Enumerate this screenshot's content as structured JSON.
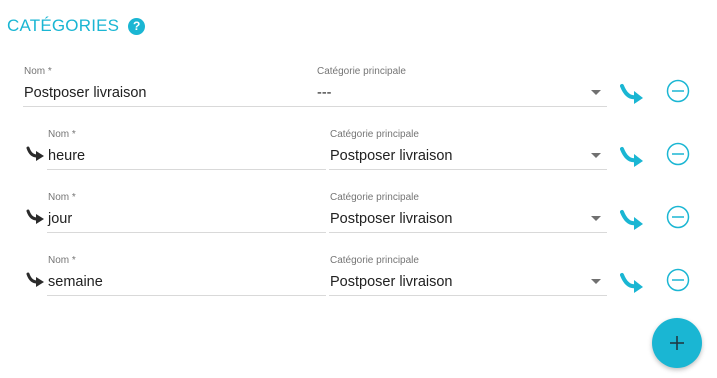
{
  "section": {
    "title": "CATÉGORIES",
    "help_glyph": "?"
  },
  "colors": {
    "accent": "#1ab6d3",
    "text": "#212121",
    "label": "#757575",
    "divider": "#d9d9d9"
  },
  "icons": {
    "help": "help-circle-icon",
    "child": "subdirectory-arrow-icon",
    "move": "move-under-arrow-icon",
    "remove": "remove-circle-icon",
    "add": "plus-icon"
  },
  "rows": [
    {
      "name_label": "Nom *",
      "name": "Postposer livraison",
      "parent_label": "Catégorie principale",
      "parent": "---"
    },
    {
      "name_label": "Nom *",
      "name": "heure",
      "parent_label": "Catégorie principale",
      "parent": "Postposer livraison"
    },
    {
      "name_label": "Nom *",
      "name": "jour",
      "parent_label": "Catégorie principale",
      "parent": "Postposer livraison"
    },
    {
      "name_label": "Nom *",
      "name": "semaine",
      "parent_label": "Catégorie principale",
      "parent": "Postposer livraison"
    }
  ]
}
